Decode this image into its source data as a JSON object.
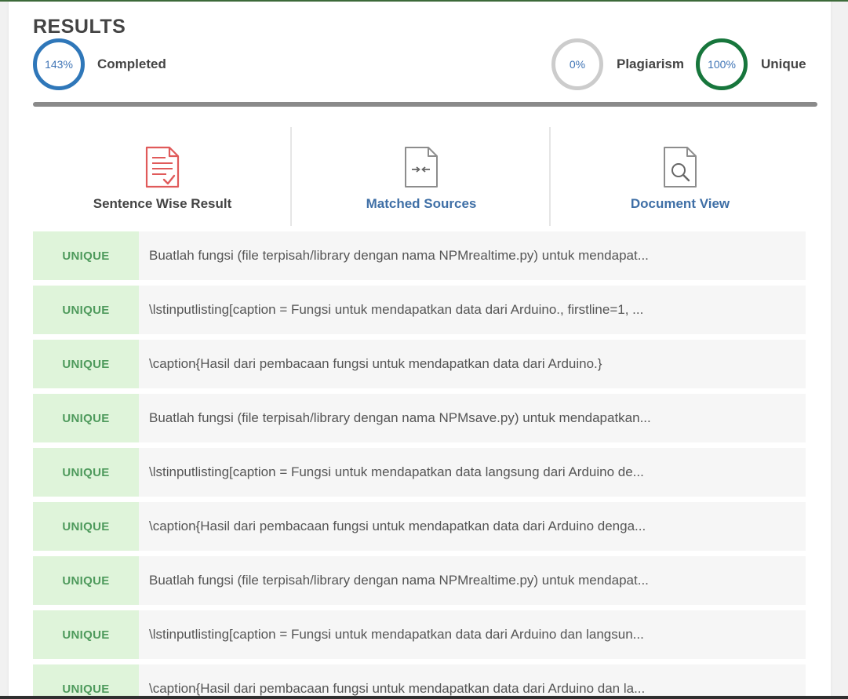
{
  "header": {
    "title": "RESULTS"
  },
  "stats": {
    "completed": {
      "value": "143%",
      "label": "Completed",
      "color": "#2f77b9"
    },
    "plagiarism": {
      "value": "0%",
      "label": "Plagiarism",
      "color": "#cccccc"
    },
    "unique": {
      "value": "100%",
      "label": "Unique",
      "color": "#17763c"
    }
  },
  "tabs": [
    {
      "label": "Sentence Wise Result",
      "icon": "document-check-icon",
      "color": "#e05a5a"
    },
    {
      "label": "Matched Sources",
      "icon": "document-compare-icon",
      "color": "#3f6fa6"
    },
    {
      "label": "Document View",
      "icon": "document-search-icon",
      "color": "#3f6fa6"
    }
  ],
  "rows": [
    {
      "status": "UNIQUE",
      "text": "Buatlah fungsi (file terpisah/library dengan nama NPMrealtime.py) untuk mendapat..."
    },
    {
      "status": "UNIQUE",
      "text": "\\lstinputlisting[caption = Fungsi untuk mendapatkan data dari Arduino., firstline=1, ..."
    },
    {
      "status": "UNIQUE",
      "text": "\\caption{Hasil dari pembacaan fungsi untuk mendapatkan data dari Arduino.}"
    },
    {
      "status": "UNIQUE",
      "text": "Buatlah fungsi (file terpisah/library dengan nama NPMsave.py) untuk mendapatkan..."
    },
    {
      "status": "UNIQUE",
      "text": "\\lstinputlisting[caption = Fungsi untuk mendapatkan data langsung dari Arduino de..."
    },
    {
      "status": "UNIQUE",
      "text": "\\caption{Hasil dari pembacaan fungsi untuk mendapatkan data dari Arduino denga..."
    },
    {
      "status": "UNIQUE",
      "text": "Buatlah fungsi (file terpisah/library dengan nama NPMrealtime.py) untuk mendapat..."
    },
    {
      "status": "UNIQUE",
      "text": "\\lstinputlisting[caption = Fungsi untuk mendapatkan data dari Arduino dan langsun..."
    },
    {
      "status": "UNIQUE",
      "text": "\\caption{Hasil dari pembacaan fungsi untuk mendapatkan data dari Arduino dan la..."
    }
  ],
  "colors": {
    "accent_blue": "#3f6fa6",
    "unique_badge_bg": "#dff4da",
    "unique_badge_text": "#4e9a5c"
  }
}
